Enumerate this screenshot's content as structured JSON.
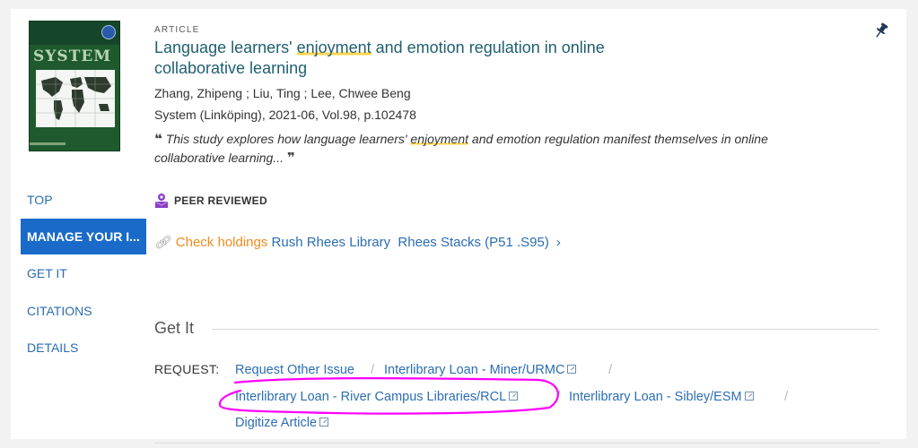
{
  "record": {
    "type": "ARTICLE",
    "title_parts": [
      "Language learners' ",
      "enjoyment",
      " and emotion regulation in online collaborative learning"
    ],
    "authors": "Zhang, Zhipeng ; Liu, Ting ; Lee, Chwee Beng",
    "source": "System (Linköping), 2021-06, Vol.98, p.102478",
    "abstract_parts": [
      "This study explores how language learners' ",
      "enjoyment",
      " and emotion regulation manifest themselves in online collaborative learning..."
    ],
    "quote_open": "❝",
    "quote_close": "❞",
    "cover_title": "SYSTEM"
  },
  "nav": {
    "items": [
      {
        "label": "TOP"
      },
      {
        "label": "MANAGE YOUR I...",
        "active": true
      },
      {
        "label": "GET IT"
      },
      {
        "label": "CITATIONS"
      },
      {
        "label": "DETAILS"
      }
    ]
  },
  "badges": {
    "peer_reviewed": "PEER REVIEWED"
  },
  "holdings": {
    "link_label": "Check holdings",
    "library": "Rush Rhees Library",
    "location": "Rhees Stacks (P51 .S95)"
  },
  "get_it": {
    "title": "Get It",
    "request_label": "REQUEST:",
    "links": [
      "Request Other Issue",
      "Interlibrary Loan - Miner/URMC",
      "Interlibrary Loan - River Campus Libraries/RCL",
      "Interlibrary Loan - Sibley/ESM",
      "Digitize Article"
    ]
  },
  "icons": {
    "pin": "pin-icon",
    "peer": "peer-reviewed-icon",
    "link": "link-icon",
    "external": "external-link-icon"
  },
  "colors": {
    "accent": "#1a6bc9",
    "link": "#2b6db3",
    "title": "#1f5f70",
    "highlight": "#ffd54a",
    "check_holdings": "#f28b1e",
    "annotation": "#ff00ff"
  }
}
